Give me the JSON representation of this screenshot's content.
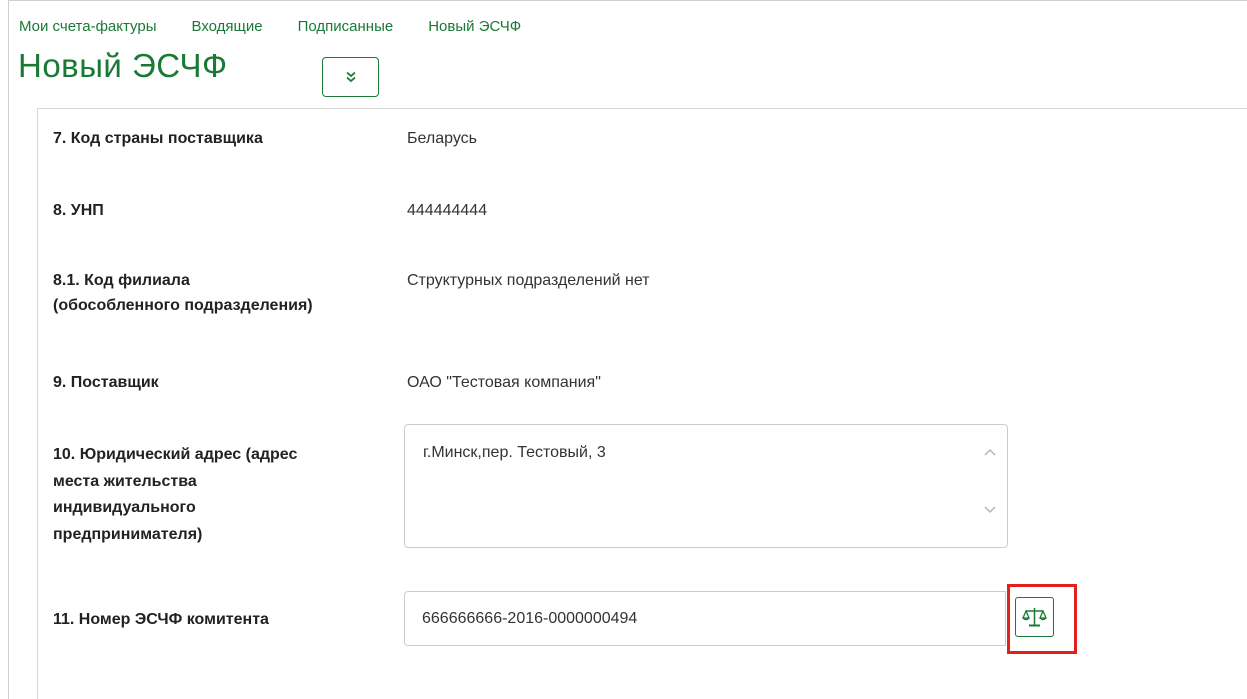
{
  "nav": {
    "links": [
      "Мои счета-фактуры",
      "Входящие",
      "Подписанные",
      "Новый ЭСЧФ"
    ]
  },
  "page": {
    "title": "Новый ЭСЧФ"
  },
  "fields": {
    "f7": {
      "label": "7. Код страны поставщика",
      "value": "Беларусь"
    },
    "f8": {
      "label": "8. УНП",
      "value": "444444444"
    },
    "f8_1": {
      "label_line1": "8.1. Код филиала",
      "label_line2": "(обособленного подразделения)",
      "value": "Структурных подразделений нет"
    },
    "f9": {
      "label": "9. Поставщик",
      "value": "ОАО \"Тестовая компания\""
    },
    "f10": {
      "label_lines": [
        "10. Юридический адрес (адрес",
        "места жительства",
        "индивидуального",
        "предпринимателя)"
      ],
      "value": "г.Минск,пер. Тестовый, 3"
    },
    "f11": {
      "label": "11. Номер ЭСЧФ комитента",
      "value": "666666666-2016-0000000494"
    }
  },
  "icons": {
    "dropdown": "double-chevron-down-icon",
    "scale": "scale-balance-icon"
  },
  "colors": {
    "accent": "#1a7a35",
    "highlight": "#e0211c"
  }
}
